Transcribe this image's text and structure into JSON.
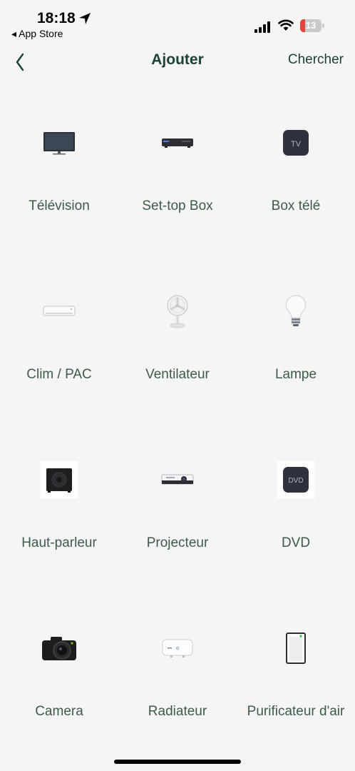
{
  "status_bar": {
    "time": "18:18",
    "back_app": "◂ App Store",
    "battery": "13"
  },
  "nav": {
    "title": "Ajouter",
    "search": "Chercher"
  },
  "devices": [
    {
      "label": "Télévision",
      "icon": "television-icon"
    },
    {
      "label": "Set-top Box",
      "icon": "set-top-box-icon"
    },
    {
      "label": "Box télé",
      "icon": "tv-box-icon",
      "badge": "TV"
    },
    {
      "label": "Clim / PAC",
      "icon": "air-conditioner-icon"
    },
    {
      "label": "Ventilateur",
      "icon": "fan-icon"
    },
    {
      "label": "Lampe",
      "icon": "lamp-icon"
    },
    {
      "label": "Haut-parleur",
      "icon": "speaker-icon"
    },
    {
      "label": "Projecteur",
      "icon": "projector-icon"
    },
    {
      "label": "DVD",
      "icon": "dvd-icon",
      "badge": "DVD"
    },
    {
      "label": "Camera",
      "icon": "camera-icon"
    },
    {
      "label": "Radiateur",
      "icon": "heater-icon"
    },
    {
      "label": "Purificateur d'air",
      "icon": "air-purifier-icon"
    }
  ],
  "colors": {
    "background": "#f5f5f5",
    "accent": "#1b4332",
    "label": "#3d5c47",
    "battery_low": "#e0453f"
  }
}
